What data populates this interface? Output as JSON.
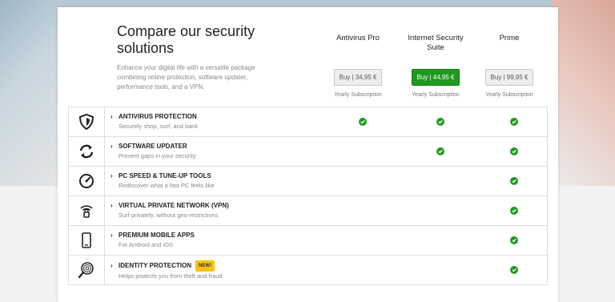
{
  "header": {
    "title": "Compare our security solutions",
    "subtitle": "Enhance your digital life with a versatile package combining online protection, software updater, performance tools, and a VPN."
  },
  "products": [
    {
      "name": "Antivirus Pro",
      "buy_label": "Buy | 34,95 €",
      "subscription": "Yearly Subscription",
      "highlight": false
    },
    {
      "name": "Internet Security Suite",
      "buy_label": "Buy | 44,95 €",
      "subscription": "Yearly Subscription",
      "highlight": true
    },
    {
      "name": "Prime",
      "buy_label": "Buy | 99,95 €",
      "subscription": "Yearly Subscription",
      "highlight": false
    }
  ],
  "features": [
    {
      "name": "ANTIVIRUS PROTECTION",
      "desc": "Securely shop, surf, and bank",
      "icon": "shield-icon",
      "included": [
        true,
        true,
        true
      ]
    },
    {
      "name": "SOFTWARE UPDATER",
      "desc": "Prevent gaps in your security",
      "icon": "refresh-arrows-icon",
      "included": [
        false,
        true,
        true
      ]
    },
    {
      "name": "PC SPEED & TUNE-UP TOOLS",
      "desc": "Rediscover what a fast PC feels like",
      "icon": "speedometer-icon",
      "included": [
        false,
        false,
        true
      ]
    },
    {
      "name": "VIRTUAL PRIVATE NETWORK (VPN)",
      "desc": "Surf privately, without geo-restrictions",
      "icon": "wifi-lock-icon",
      "included": [
        false,
        false,
        true
      ]
    },
    {
      "name": "PREMIUM MOBILE APPS",
      "desc": "For Android and iOS",
      "icon": "smartphone-icon",
      "included": [
        false,
        false,
        true
      ]
    },
    {
      "name": "IDENTITY PROTECTION",
      "badge": "NEW!",
      "desc": "Helps protects you from theft and fraud",
      "icon": "fingerprint-search-icon",
      "included": [
        false,
        false,
        true
      ]
    }
  ],
  "colors": {
    "accent_green": "#1f9a1f",
    "badge_yellow": "#f5c116"
  }
}
